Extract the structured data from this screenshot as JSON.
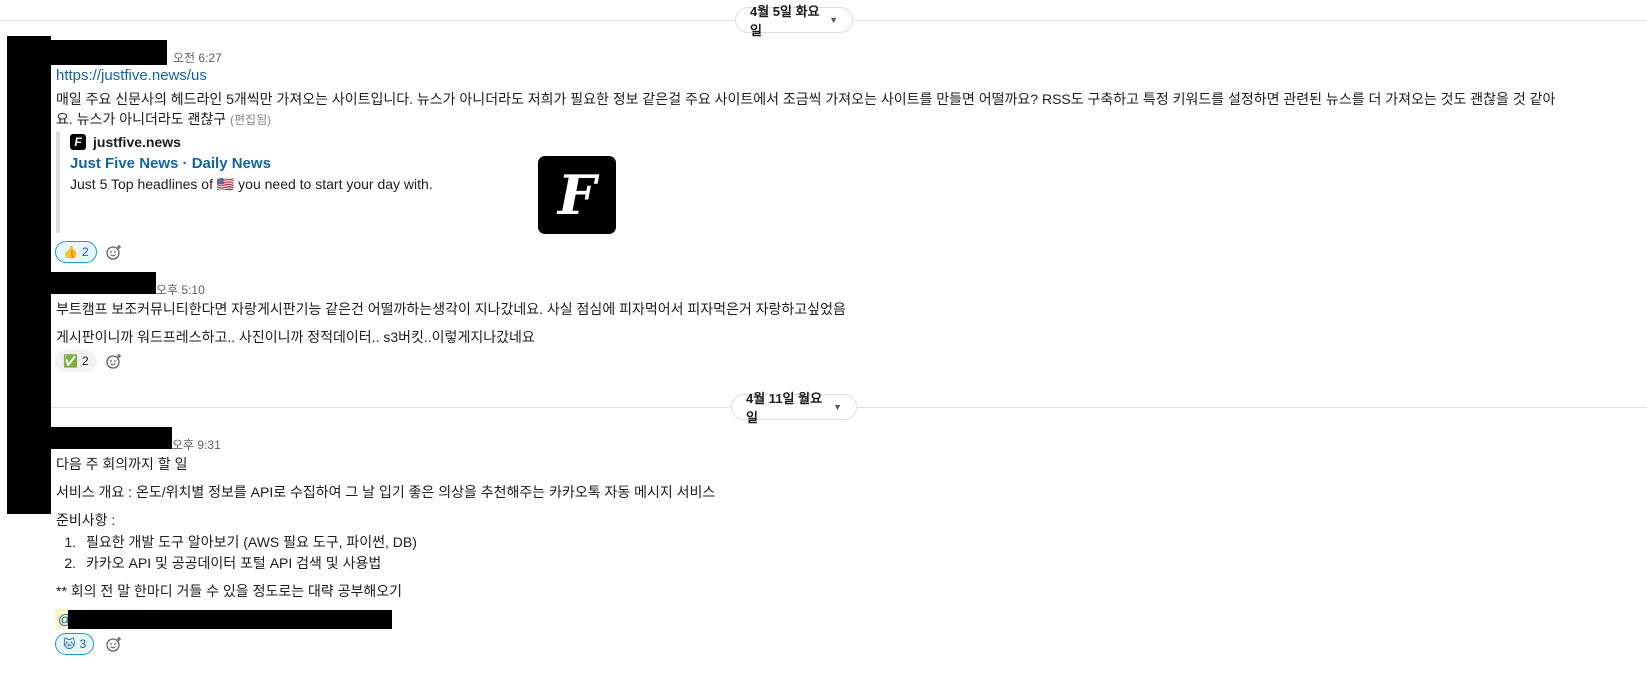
{
  "dividers": [
    {
      "label": "4월 5일 화요일"
    },
    {
      "label": "4월 11일 월요일"
    }
  ],
  "messages": [
    {
      "time": "오전 6:27",
      "link": "https://justfive.news/us",
      "text1": "매일 주요 신문사의 헤드라인 5개씩만 가져오는 사이트입니다. 뉴스가 아니더라도 저희가 필요한 정보 같은걸 주요 사이트에서 조금씩 가져오는 사이트를 만들면 어떨까요? RSS도 구축하고 특정 키워드를 설정하면 관련된 뉴스를 더 가져오는 것도 괜찮을 것 같아",
      "text2": "요.  뉴스가 아니더라도 괜찮구",
      "edited": "(편집됨)",
      "unfurl": {
        "site": "justfive.news",
        "title": "Just Five News · Daily News",
        "description_before": "Just 5 Top headlines of ",
        "flag": "🇺🇸",
        "description_after": " you need to start your day with.",
        "logo_letter": "F"
      },
      "reaction": {
        "emoji": "👍",
        "count": "2"
      }
    },
    {
      "time": "오후 5:10",
      "text1": "부트캠프 보조커뮤니티한다면 자랑게시판기능 같은건 어떨까하는생각이 지나갔네요. 사실 점심에 피자먹어서 피자먹은거 자랑하고싶었음",
      "text2": "게시판이니까 워드프레스하고.. 사진이니까 정적데이터.. s3버킷..이렇게지나갔네요",
      "reaction": {
        "emoji": "✅",
        "count": "2"
      }
    },
    {
      "time": "오후 9:31",
      "line1": "다음 주 회의까지 할 일",
      "line2": "서비스 개요 : 온도/위치별 정보를 API로 수집하여 그 날 입기 좋은 의상을 추천해주는 카카오톡 자동 메시지 서비스",
      "line3": "준비사항 :",
      "list": [
        {
          "num": "1.",
          "text": "필요한 개발 도구 알아보기 (AWS 필요 도구, 파이썬, DB)"
        },
        {
          "num": "2.",
          "text": "카카오 API 및 공공데이터 포털 API 검색 및 사용법"
        }
      ],
      "line4": "** 회의 전 말 한마디 거들 수 있을 정도로는 대략 공부해오기",
      "mention_prefix": "@",
      "reaction": {
        "emoji": "🐱",
        "count": "3"
      }
    }
  ],
  "icons": {
    "chevron": "chevron-down-icon",
    "add_reaction": "add-reaction-icon",
    "site_favicon": "justfive-favicon-icon",
    "logo": "justfive-logo-icon"
  },
  "colors": {
    "link": "#1264a3",
    "reaction_active_border": "#1d9bd1",
    "reaction_active_bg": "#e8f5fa",
    "mention_bg": "#fdf2c4"
  }
}
